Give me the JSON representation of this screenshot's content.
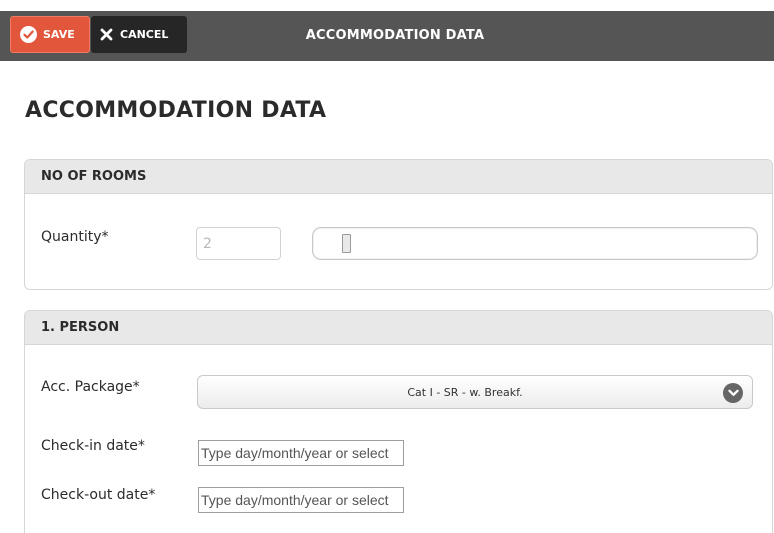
{
  "toolbar": {
    "save_label": "SAVE",
    "cancel_label": "CANCEL",
    "title": "ACCOMMODATION DATA"
  },
  "page": {
    "title": "ACCOMMODATION DATA"
  },
  "rooms_section": {
    "heading": "NO OF ROOMS",
    "quantity_label": "Quantity*",
    "quantity_value": "2",
    "slider_level": 0
  },
  "person_section": {
    "heading": "1. PERSON",
    "package_label": "Acc. Package*",
    "package_value": "Cat I - SR - w. Breakf.",
    "checkin_label": "Check-in date*",
    "checkin_placeholder": "Type day/month/year or select",
    "checkout_label": "Check-out date*",
    "checkout_placeholder": "Type day/month/year or select"
  },
  "colors": {
    "toolbar_bg": "#555555",
    "save_bg": "#e2563b",
    "cancel_bg": "#262626",
    "section_header_bg": "#e8e8e8"
  },
  "icons": {
    "save": "check-icon",
    "cancel": "close-icon",
    "select": "chevron-down-icon"
  }
}
